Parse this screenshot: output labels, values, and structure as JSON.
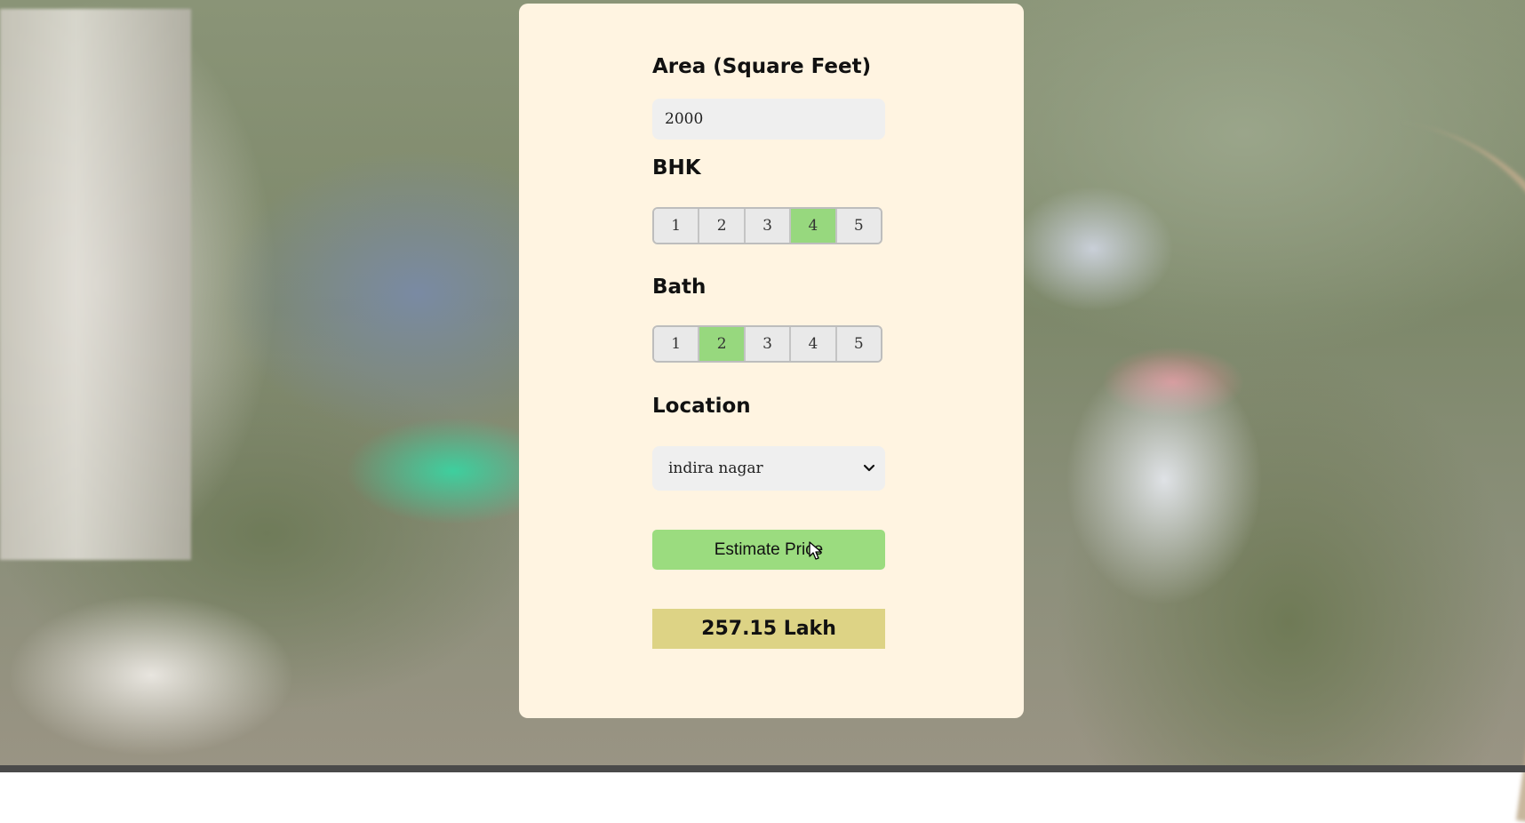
{
  "form": {
    "area": {
      "label": "Area (Square Feet)",
      "value": "2000"
    },
    "bhk": {
      "label": "BHK",
      "options": [
        "1",
        "2",
        "3",
        "4",
        "5"
      ],
      "selected": "4"
    },
    "bath": {
      "label": "Bath",
      "options": [
        "1",
        "2",
        "3",
        "4",
        "5"
      ],
      "selected": "2"
    },
    "location": {
      "label": "Location",
      "selected": "indira nagar"
    },
    "estimate_button": "Estimate Price",
    "result": "257.15 Lakh"
  },
  "colors": {
    "card_background": "#fff4e1",
    "active_option": "#97d87e",
    "button": "#9bdc7f",
    "result_background": "#ddd385"
  },
  "icons": {
    "location_dropdown": "chevron-down-icon",
    "cursor": "mouse-pointer-icon"
  }
}
